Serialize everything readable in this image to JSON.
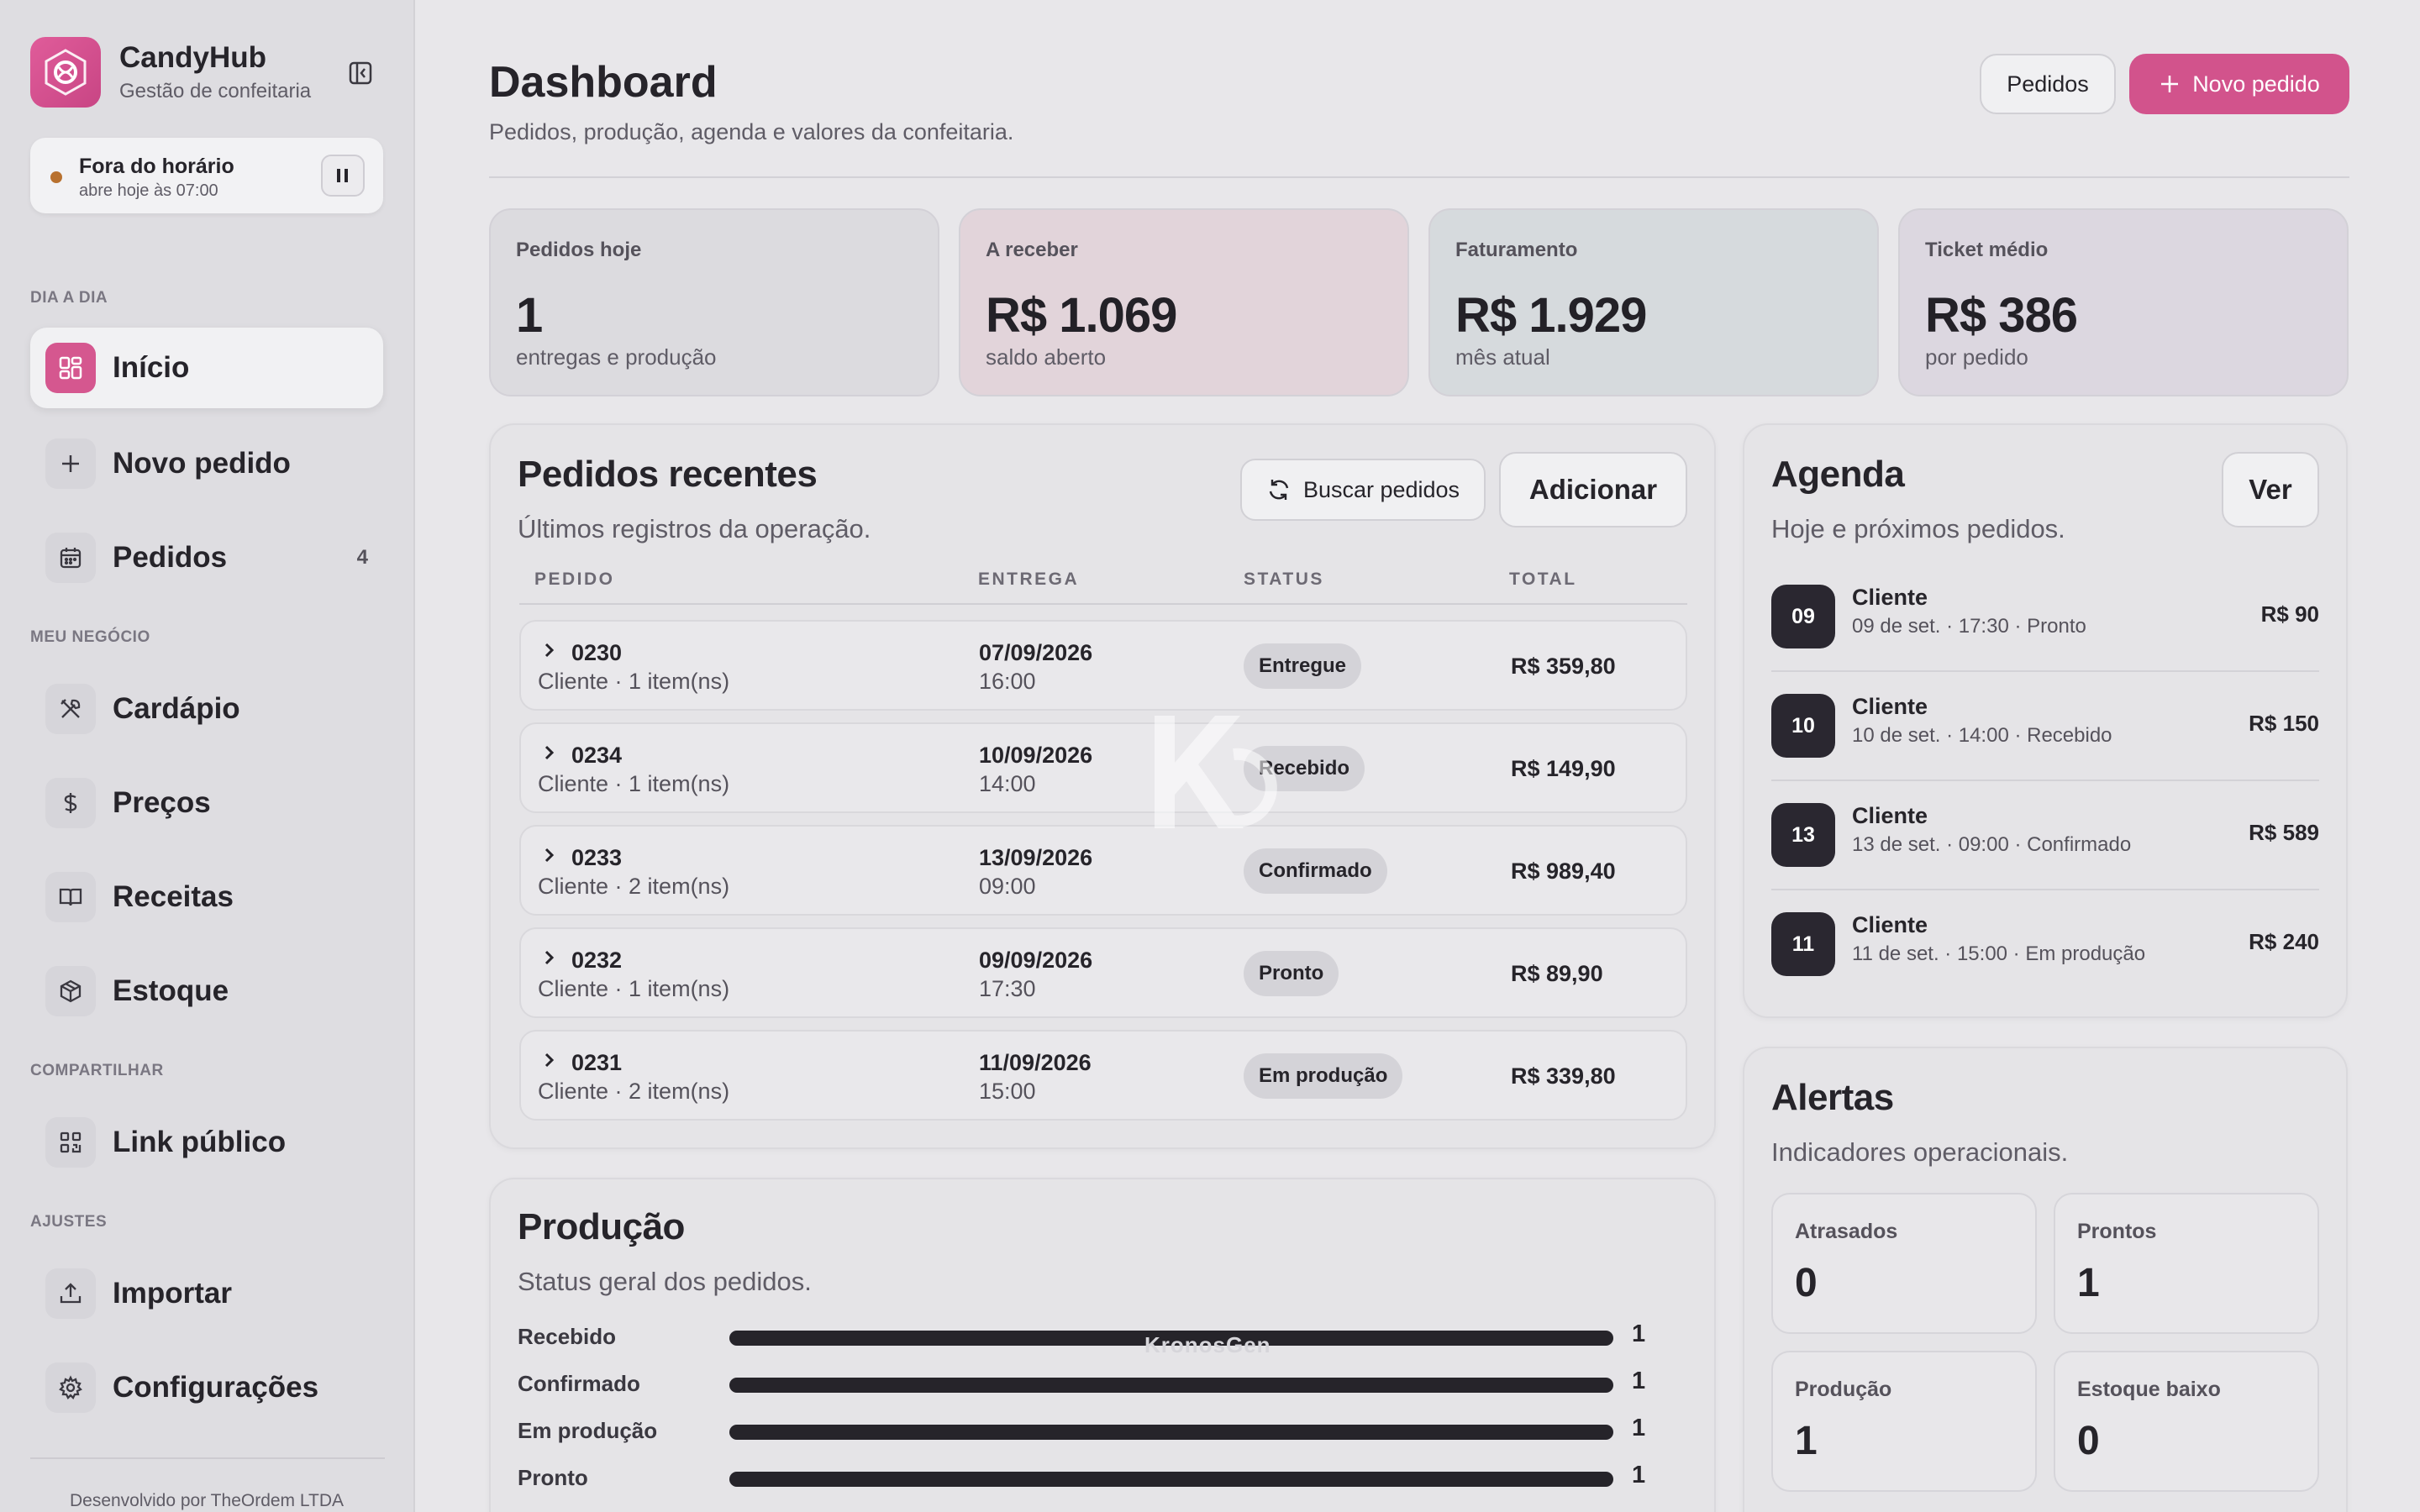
{
  "sidebar": {
    "brand_name": "CandyHub",
    "brand_sub": "Gestão de confeitaria",
    "status": {
      "title": "Fora do horário",
      "sub": "abre hoje às 07:00"
    },
    "sections": [
      "DIA A DIA",
      "MEU NEGÓCIO",
      "COMPARTILHAR",
      "AJUSTES"
    ],
    "items": [
      {
        "label": "Início",
        "icon": "grid-icon",
        "active": true
      },
      {
        "label": "Novo pedido",
        "icon": "plus-icon"
      },
      {
        "label": "Pedidos",
        "icon": "calendar-icon",
        "count": "4"
      },
      {
        "label": "Cardápio",
        "icon": "utensils-icon"
      },
      {
        "label": "Preços",
        "icon": "dollar-icon"
      },
      {
        "label": "Receitas",
        "icon": "book-icon"
      },
      {
        "label": "Estoque",
        "icon": "box-icon"
      },
      {
        "label": "Link público",
        "icon": "qr-icon"
      },
      {
        "label": "Importar",
        "icon": "upload-icon"
      },
      {
        "label": "Configurações",
        "icon": "gear-icon"
      }
    ],
    "footer": "Desenvolvido por TheOrdem LTDA"
  },
  "header": {
    "title": "Dashboard",
    "subtitle": "Pedidos, produção, agenda e valores da confeitaria.",
    "orders_button": "Pedidos",
    "new_order_button": "Novo pedido"
  },
  "kpis": [
    {
      "label": "Pedidos hoje",
      "value": "1",
      "sub": "entregas e produção",
      "color": "#dcdbdf"
    },
    {
      "label": "A receber",
      "value": "R$ 1.069",
      "sub": "saldo aberto",
      "color": "#e2d4da"
    },
    {
      "label": "Faturamento",
      "value": "R$ 1.929",
      "sub": "mês atual",
      "color": "#d6dadd"
    },
    {
      "label": "Ticket médio",
      "value": "R$ 386",
      "sub": "por pedido",
      "color": "#dcd7e0"
    }
  ],
  "recent": {
    "title": "Pedidos recentes",
    "subtitle": "Últimos registros da operação.",
    "refresh_button": "Buscar pedidos",
    "add_button": "Adicionar",
    "columns": [
      "PEDIDO",
      "ENTREGA",
      "STATUS",
      "TOTAL"
    ],
    "rows": [
      {
        "id": "0230",
        "client": "Cliente · 1 item(ns)",
        "date": "07/09/2026",
        "time": "16:00",
        "status": "Entregue",
        "total": "R$ 359,80"
      },
      {
        "id": "0234",
        "client": "Cliente · 1 item(ns)",
        "date": "10/09/2026",
        "time": "14:00",
        "status": "Recebido",
        "total": "R$ 149,90"
      },
      {
        "id": "0233",
        "client": "Cliente · 2 item(ns)",
        "date": "13/09/2026",
        "time": "09:00",
        "status": "Confirmado",
        "total": "R$ 989,40"
      },
      {
        "id": "0232",
        "client": "Cliente · 1 item(ns)",
        "date": "09/09/2026",
        "time": "17:30",
        "status": "Pronto",
        "total": "R$ 89,90"
      },
      {
        "id": "0231",
        "client": "Cliente · 2 item(ns)",
        "date": "11/09/2026",
        "time": "15:00",
        "status": "Em produção",
        "total": "R$ 339,80"
      }
    ]
  },
  "production": {
    "title": "Produção",
    "subtitle": "Status geral dos pedidos.",
    "rows": [
      {
        "label": "Recebido",
        "count": "1",
        "fraction": 1
      },
      {
        "label": "Confirmado",
        "count": "1",
        "fraction": 1
      },
      {
        "label": "Em produção",
        "count": "1",
        "fraction": 1
      },
      {
        "label": "Pronto",
        "count": "1",
        "fraction": 1
      }
    ]
  },
  "agenda": {
    "title": "Agenda",
    "subtitle": "Hoje e próximos pedidos.",
    "view_button": "Ver",
    "items": [
      {
        "day": "09",
        "name": "Cliente",
        "meta": "09 de set. · 17:30 · Pronto",
        "value": "R$ 90"
      },
      {
        "day": "10",
        "name": "Cliente",
        "meta": "10 de set. · 14:00 · Recebido",
        "value": "R$ 150"
      },
      {
        "day": "13",
        "name": "Cliente",
        "meta": "13 de set. · 09:00 · Confirmado",
        "value": "R$ 589"
      },
      {
        "day": "11",
        "name": "Cliente",
        "meta": "11 de set. · 15:00 · Em produção",
        "value": "R$ 240"
      }
    ]
  },
  "alerts": {
    "title": "Alertas",
    "subtitle": "Indicadores operacionais.",
    "tiles": [
      {
        "label": "Atrasados",
        "value": "0"
      },
      {
        "label": "Prontos",
        "value": "1"
      },
      {
        "label": "Produção",
        "value": "1"
      },
      {
        "label": "Estoque baixo",
        "value": "0"
      }
    ]
  },
  "watermark": "KronosGen",
  "colors": {
    "accent": "#d2538c",
    "dark": "#26242a"
  }
}
